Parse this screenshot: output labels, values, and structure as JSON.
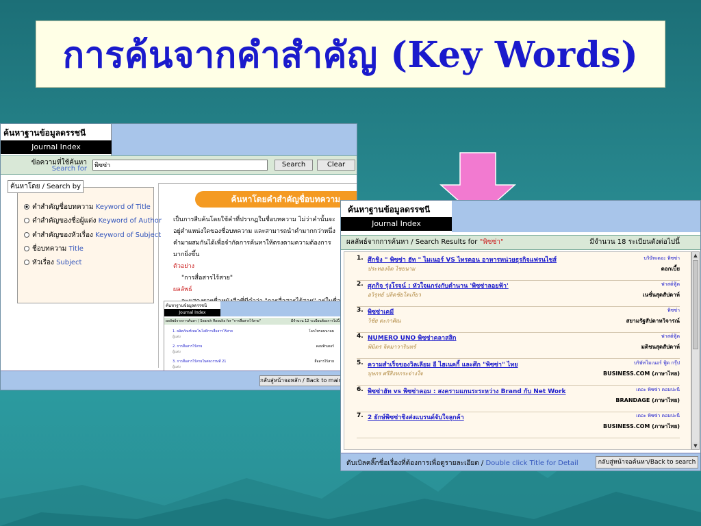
{
  "slide": {
    "title": "การค้นจากคำสำคัญ (Key Words)"
  },
  "left_window": {
    "brand_th": "ค้นหาฐานข้อมูลดรรชนีวารสาร",
    "brand_en": "Journal Index",
    "search_label_th": "ข้อความที่ใช้ค้นหา",
    "search_label_en": "Search for",
    "search_value": "พิซซ่า",
    "search_button": "Search",
    "clear_button": "Clear",
    "search_by_label": "ค้นหาโดย / Search by",
    "options": [
      {
        "th": "คำสำคัญชื่อบทความ",
        "en": "Keyword of Title",
        "selected": true
      },
      {
        "th": "คำสำคัญของชื่อผู้แต่ง",
        "en": "Keyword of Author",
        "selected": false
      },
      {
        "th": "คำสำคัญของหัวเรื่อง",
        "en": "Keyword of Subject",
        "selected": false
      },
      {
        "th": "ชื่อบทความ",
        "en": "Title",
        "selected": false
      },
      {
        "th": "หัวเรื่อง",
        "en": "Subject",
        "selected": false
      }
    ],
    "banner": "ค้นหาโดยคำสำคัญชื่อบทความ",
    "para1": "เป็นการสืบค้นโดยใช้คำที่ปรากฏในชื่อบทความ ไม่ว่าคำนั้นจะอยู่ตำแหน่งใดของชื่อบทความ และสามารถนำคำมากกว่าหนึ่งคำมาผสมกันได้เพื่อจำกัดการค้นหาให้ตรงตามความต้องการมากยิ่งขึ้น",
    "example_label": "ตัวอย่าง",
    "example_value": "\"การสื่อสารไร้สาย\"",
    "result_label": "ผลลัพธ์",
    "result_text": "จะแสดงรายชื่อหนังสือที่มีคำว่า \"การสื่อสารไร้สาย\" อยู่ในชื่อเรื่องทั้งหมด",
    "footer_button": "กลับสู่หน้าจอหลัก / Back to main menu",
    "mini": {
      "brand_th": "ค้นหาฐานข้อมูลดรรชนีวารสาร",
      "brand_en": "Journal Index",
      "results": "ผลลัพธ์จากการค้นหา / Search Results for \"การสื่อสารไร้สาย\"",
      "count": "มีจำนวน 12 ระเบียนต้องการไปนี้",
      "rows": [
        {
          "num": "1.",
          "title": "ผลิตภัณฑ์เทคโนโลยีการสื่อสารไร้สาย",
          "sub": "ผู้แต่ง",
          "src": "โลกโทรคมนาคม"
        },
        {
          "num": "2.",
          "title": "การสื่อสารไร้สาย",
          "sub": "ผู้แต่ง",
          "src": "คอมพิวเตอร์"
        },
        {
          "num": "3.",
          "title": "การสื่อสารไร้สายในศตวรรษที่ 21",
          "sub": "ผู้แต่ง",
          "src": "สื่อสารไร้สาย"
        }
      ]
    }
  },
  "right_window": {
    "brand_th": "ค้นหาฐานข้อมูลดรรชนีวารสาร",
    "brand_en": "Journal Index",
    "results_label": "ผลลัพธ์จากการค้นหา / Search Results for",
    "results_query": "\"พิซซ่า\"",
    "results_count": "มีจำนวน 18 ระเบียนดังต่อไปนี้",
    "items": [
      {
        "num": "1.",
        "title": "ศึกชิง \" พิซซ่า ฮัท \" ไมเนอร์ VS ไทรคอน อาหารหน่วยธุรกิจแฟรนไชส์",
        "author": "ประทองจิต ไชยนาม",
        "col": "บริษัทเดอะ พิซซ่า",
        "src": "ดอกเบี้ย"
      },
      {
        "num": "2.",
        "title": "ศุภกิจ รุ่งโรจน์ : หัวใจแกร่งกับตำนาน 'พิซซ่าลอยฟ้า'",
        "author": "อวิรุทธ์ ปลิดชัยโตเกียว",
        "col": "ฟาสต์ฟู้ด",
        "src": "เนชั่นสุดสัปดาห์"
      },
      {
        "num": "3.",
        "title": "พิซซ่าเคมี",
        "author": "วิชัย ตะกาศิณ",
        "col": "พิซซ่า",
        "src": "สยามรัฐสัปดาหวิจารณ์"
      },
      {
        "num": "4.",
        "title": "NUMERO UNO พิซซ่าคลาสสิก",
        "author": "พิมิตร จิตมาวารินทร์",
        "col": "ฟาสต์ฟู้ด",
        "src": "มติชนสุดสัปดาห์"
      },
      {
        "num": "5.",
        "title": "ความสำเร็จของวิลเลียม อี ไฮเนคกี้ และศึก \"พิซซ่า\" ไทย",
        "author": "บุษกร ศรีสิงหกระจ่างใจ",
        "col": "บริษัทไมเนอร์ ฟู้ด กรุ๊ป",
        "src": "BUSINESS.COM (ภาษาไทย)"
      },
      {
        "num": "6.",
        "title": "พิซซ่าฮัท vs พิซซ่าคอม : สงครามแกนระระหว่าง Brand กับ Net Work",
        "author": "",
        "col": "เดอะ พิซซ่า คอมปะนี",
        "src": "BRANDAGE (ภาษาไทย)"
      },
      {
        "num": "7.",
        "title": "2 ยักษ์พิซซ่าชิงส่งแบรนด์จับใจลูกค้า",
        "author": "",
        "col": "เดอะ พิซซ่า คอมปะนี",
        "src": "BUSINESS.COM (ภาษาไทย)"
      }
    ],
    "footer_text_th": "ดับเบิลคลิ๊กชื่อเรื่องที่ต้องการเพื่อดูรายละเอียด /",
    "footer_text_en": "Double click Title for Detail",
    "footer_button": "กลับสู่หน้าจอค้นหา/Back to search page"
  },
  "colors": {
    "title": "#1a1acc",
    "arrow": "#f27ad0",
    "banner": "#f49a22"
  }
}
